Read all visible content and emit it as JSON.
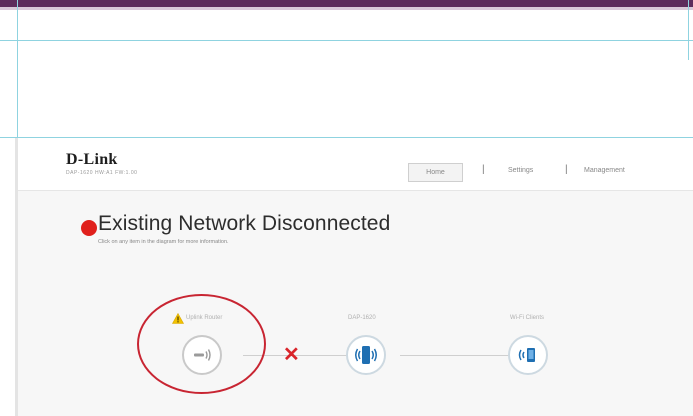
{
  "header": {
    "logo": "D-Link",
    "model_info": "DAP-1620   HW:A1   FW:1.00"
  },
  "nav": {
    "home": "Home",
    "settings": "Settings",
    "management": "Management",
    "separator": "|"
  },
  "status": {
    "title": "Existing Network Disconnected",
    "subtitle": "Click on any item in the diagram for more information.",
    "dot_color": "#e0201c"
  },
  "diagram": {
    "uplink_router_label": "Uplink Router",
    "extender_label": "DAP-1620",
    "clients_label": "Wi-Fi Clients",
    "disconnect_mark": "✕"
  },
  "icons": {
    "warning": "warning-icon",
    "router": "router-icon",
    "extender": "extender-icon",
    "clients": "wifi-clients-icon"
  },
  "colors": {
    "accent_blue": "#1f6fb2",
    "error_red": "#d9242a",
    "highlight_red": "#c82532",
    "top_band": "#5d2c5c"
  }
}
